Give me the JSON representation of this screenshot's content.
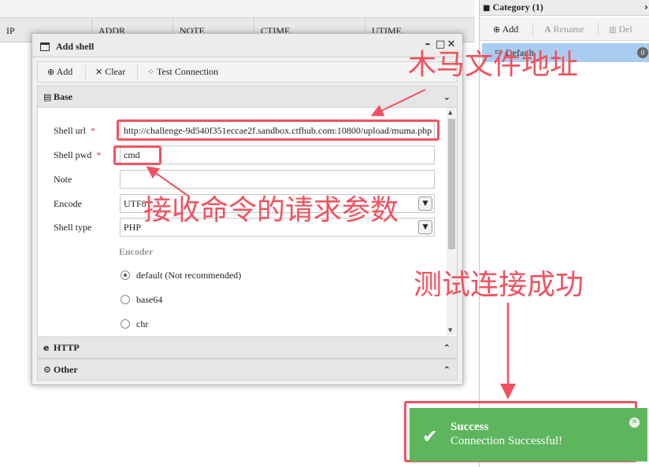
{
  "table": {
    "columns": [
      "IP",
      "ADDR",
      "NOTE",
      "CTIME",
      "UTIME"
    ]
  },
  "category_panel": {
    "title": "Category (1)",
    "toolbar": {
      "add": "Add",
      "rename": "Rename",
      "del": "Del"
    },
    "items": [
      {
        "label": "Default",
        "count": "0"
      }
    ]
  },
  "dialog": {
    "title": "Add shell",
    "toolbar": {
      "add": "Add",
      "clear": "Clear",
      "test": "Test Connection"
    },
    "base": {
      "title": "Base",
      "shell_url_label": "Shell url",
      "shell_url": "http://challenge-9d540f351eccae2f.sandbox.ctfhub.com:10800/upload/muma.php",
      "shell_pwd_label": "Shell pwd",
      "shell_pwd": "cmd",
      "note_label": "Note",
      "note": "",
      "encode_label": "Encode",
      "encode": "UTF8",
      "shell_type_label": "Shell type",
      "shell_type": "PHP",
      "encoder_legend": "Encoder",
      "encoders": [
        {
          "label": "default (Not recommended)",
          "selected": true
        },
        {
          "label": "base64",
          "selected": false
        },
        {
          "label": "chr",
          "selected": false
        }
      ],
      "required_mark": "*"
    },
    "http_title": "HTTP",
    "other_title": "Other"
  },
  "annotations": {
    "url_note": "木马文件地址",
    "pwd_note": "接收命令的请求参数",
    "test_note": "测试连接成功",
    "color": "#f2525f"
  },
  "toast": {
    "title": "Success",
    "message": "Connection Successful!",
    "color": "#5db55d"
  }
}
